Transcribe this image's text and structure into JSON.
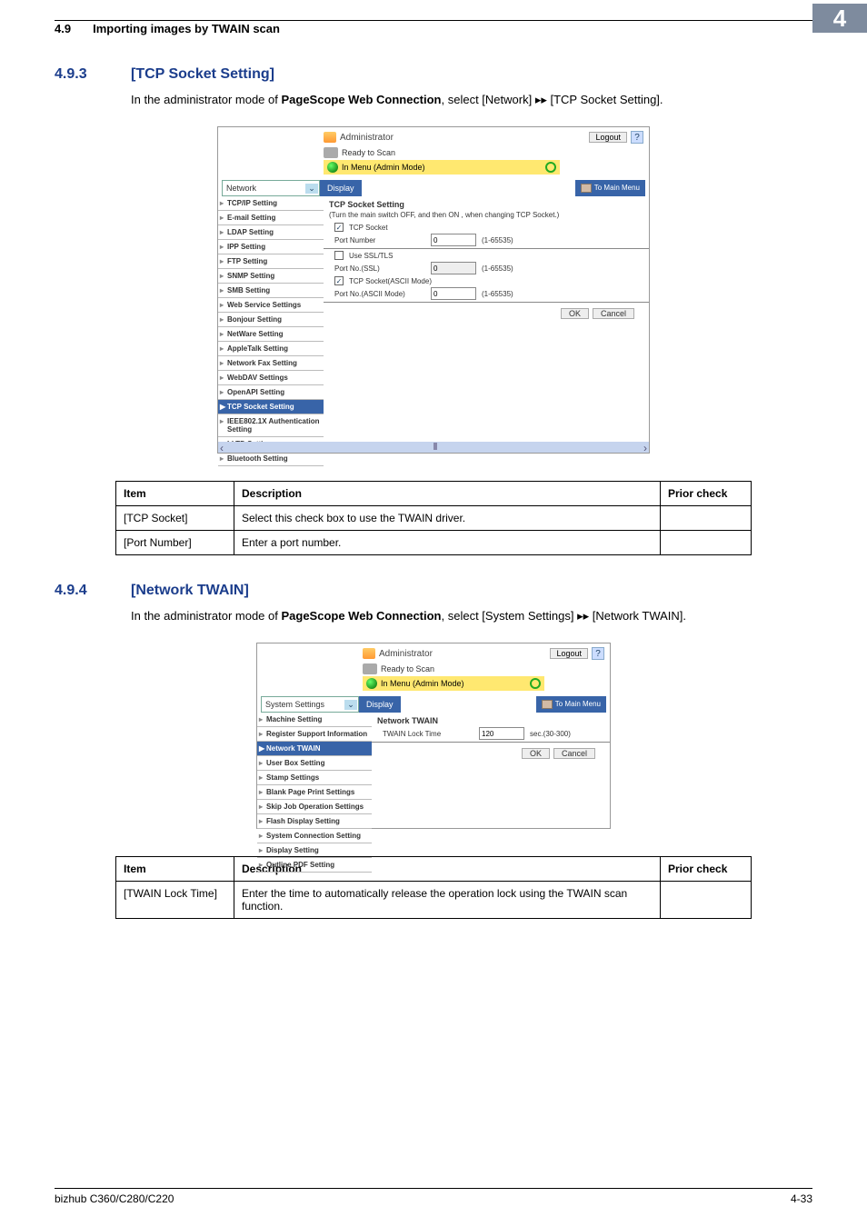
{
  "header": {
    "section_num": "4.9",
    "section_title": "Importing images by TWAIN scan",
    "chapter_badge": "4"
  },
  "sub1": {
    "num": "4.9.3",
    "title": "[TCP Socket Setting]",
    "intro_pre": "In the administrator mode of ",
    "intro_bold": "PageScope Web Connection",
    "intro_post": ", select [Network] ",
    "arrow": "▸▸",
    "intro_tail": " [TCP Socket Setting]."
  },
  "ss1": {
    "admin": "Administrator",
    "logout": "Logout",
    "help": "?",
    "ready": "Ready to Scan",
    "menu_text": "In Menu (Admin Mode)",
    "dropdown": {
      "value": "Network"
    },
    "display_btn": "Display",
    "mainmenu": "To Main Menu",
    "sidebar": [
      {
        "label": "TCP/IP Setting"
      },
      {
        "label": "E-mail Setting"
      },
      {
        "label": "LDAP Setting"
      },
      {
        "label": "IPP Setting"
      },
      {
        "label": "FTP Setting"
      },
      {
        "label": "SNMP Setting"
      },
      {
        "label": "SMB Setting"
      },
      {
        "label": "Web Service Settings"
      },
      {
        "label": "Bonjour Setting"
      },
      {
        "label": "NetWare Setting"
      },
      {
        "label": "AppleTalk Setting"
      },
      {
        "label": "Network Fax Setting"
      },
      {
        "label": "WebDAV Settings"
      },
      {
        "label": "OpenAPI Setting"
      },
      {
        "label": "TCP Socket Setting",
        "active": true
      },
      {
        "label": "IEEE802.1X Authentication Setting"
      },
      {
        "label": "LLTD Setting"
      },
      {
        "label": "Bluetooth Setting"
      }
    ],
    "content": {
      "title": "TCP Socket Setting",
      "note": "(Turn the main switch OFF, and then ON , when changing TCP Socket.)",
      "rows": [
        {
          "type": "check",
          "checked": true,
          "label": "TCP Socket"
        },
        {
          "type": "port",
          "label": "Port Number",
          "value": "0",
          "range": "(1-65535)"
        },
        {
          "type": "hr"
        },
        {
          "type": "check",
          "checked": false,
          "label": "Use SSL/TLS"
        },
        {
          "type": "port",
          "label": "Port No.(SSL)",
          "value": "0",
          "range": "(1-65535)",
          "disabled": true
        },
        {
          "type": "check",
          "checked": true,
          "label": "TCP Socket(ASCII Mode)"
        },
        {
          "type": "port",
          "label": "Port No.(ASCII Mode)",
          "value": "0",
          "range": "(1-65535)"
        }
      ],
      "ok": "OK",
      "cancel": "Cancel"
    }
  },
  "table1": {
    "head": {
      "item": "Item",
      "desc": "Description",
      "prior": "Prior check"
    },
    "rows": [
      {
        "item": "[TCP Socket]",
        "desc": "Select this check box to use the TWAIN driver.",
        "prior": ""
      },
      {
        "item": "[Port Number]",
        "desc": "Enter a port number.",
        "prior": ""
      }
    ]
  },
  "sub2": {
    "num": "4.9.4",
    "title": "[Network TWAIN]",
    "intro_pre": "In the administrator mode of ",
    "intro_bold": "PageScope Web Connection",
    "intro_post": ", select [System Settings] ",
    "arrow": "▸▸",
    "intro_tail": " [Network TWAIN]."
  },
  "ss2": {
    "admin": "Administrator",
    "logout": "Logout",
    "help": "?",
    "ready": "Ready to Scan",
    "menu_text": "In Menu (Admin Mode)",
    "dropdown": {
      "value": "System Settings"
    },
    "display_btn": "Display",
    "mainmenu": "To Main Menu",
    "sidebar": [
      {
        "label": "Machine Setting"
      },
      {
        "label": "Register Support Information"
      },
      {
        "label": "Network TWAIN",
        "active": true
      },
      {
        "label": "User Box Setting"
      },
      {
        "label": "Stamp Settings"
      },
      {
        "label": "Blank Page Print Settings"
      },
      {
        "label": "Skip Job Operation Settings"
      },
      {
        "label": "Flash Display Setting"
      },
      {
        "label": "System Connection Setting"
      },
      {
        "label": "Display Setting"
      },
      {
        "label": "Outline PDF Setting"
      }
    ],
    "content": {
      "title": "Network TWAIN",
      "row": {
        "label": "TWAIN Lock Time",
        "value": "120",
        "range": "sec.(30-300)"
      },
      "ok": "OK",
      "cancel": "Cancel"
    }
  },
  "table2": {
    "head": {
      "item": "Item",
      "desc": "Description",
      "prior": "Prior check"
    },
    "rows": [
      {
        "item": "[TWAIN Lock Time]",
        "desc": "Enter the time to automatically release the operation lock using the TWAIN scan function.",
        "prior": ""
      }
    ]
  },
  "footer": {
    "left": "bizhub C360/C280/C220",
    "right": "4-33"
  }
}
